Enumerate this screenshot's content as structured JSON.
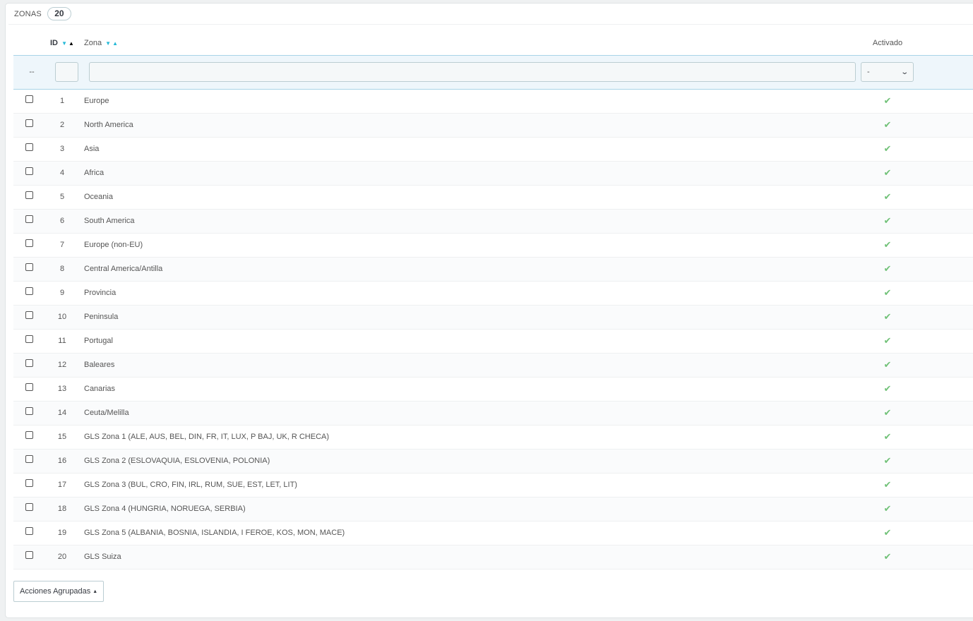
{
  "panel": {
    "title": "ZONAS",
    "count": "20"
  },
  "columns": {
    "id": "ID",
    "zone": "Zona",
    "active": "Activado"
  },
  "sort_icons": {
    "desc": "▼",
    "asc": "▲"
  },
  "filter": {
    "placeholder_bulk": "--",
    "active_value": "-",
    "chevron": "⌄"
  },
  "check_symbol": "✔",
  "rows": [
    {
      "id": "1",
      "name": "Europe",
      "active": true
    },
    {
      "id": "2",
      "name": "North America",
      "active": true
    },
    {
      "id": "3",
      "name": "Asia",
      "active": true
    },
    {
      "id": "4",
      "name": "Africa",
      "active": true
    },
    {
      "id": "5",
      "name": "Oceania",
      "active": true
    },
    {
      "id": "6",
      "name": "South America",
      "active": true
    },
    {
      "id": "7",
      "name": "Europe (non-EU)",
      "active": true
    },
    {
      "id": "8",
      "name": "Central America/Antilla",
      "active": true
    },
    {
      "id": "9",
      "name": "Provincia",
      "active": true
    },
    {
      "id": "10",
      "name": "Peninsula",
      "active": true
    },
    {
      "id": "11",
      "name": "Portugal",
      "active": true
    },
    {
      "id": "12",
      "name": "Baleares",
      "active": true
    },
    {
      "id": "13",
      "name": "Canarias",
      "active": true
    },
    {
      "id": "14",
      "name": "Ceuta/Melilla",
      "active": true
    },
    {
      "id": "15",
      "name": "GLS Zona 1 (ALE, AUS, BEL, DIN, FR, IT, LUX, P BAJ, UK, R CHECA)",
      "active": true
    },
    {
      "id": "16",
      "name": "GLS Zona 2 (ESLOVAQUIA, ESLOVENIA, POLONIA)",
      "active": true
    },
    {
      "id": "17",
      "name": "GLS Zona 3 (BUL, CRO, FIN, IRL, RUM, SUE, EST, LET, LIT)",
      "active": true
    },
    {
      "id": "18",
      "name": "GLS Zona 4 (HUNGRIA, NORUEGA, SERBIA)",
      "active": true
    },
    {
      "id": "19",
      "name": "GLS Zona 5 (ALBANIA, BOSNIA, ISLANDIA, I FEROE, KOS, MON, MACE)",
      "active": true
    },
    {
      "id": "20",
      "name": "GLS Suiza",
      "active": true
    }
  ],
  "bulk_actions": {
    "label": "Acciones Agrupadas",
    "caret": "▲"
  },
  "colors": {
    "accent": "#25b9d7",
    "check": "#72c279",
    "filter_bg": "#eef6fb"
  }
}
